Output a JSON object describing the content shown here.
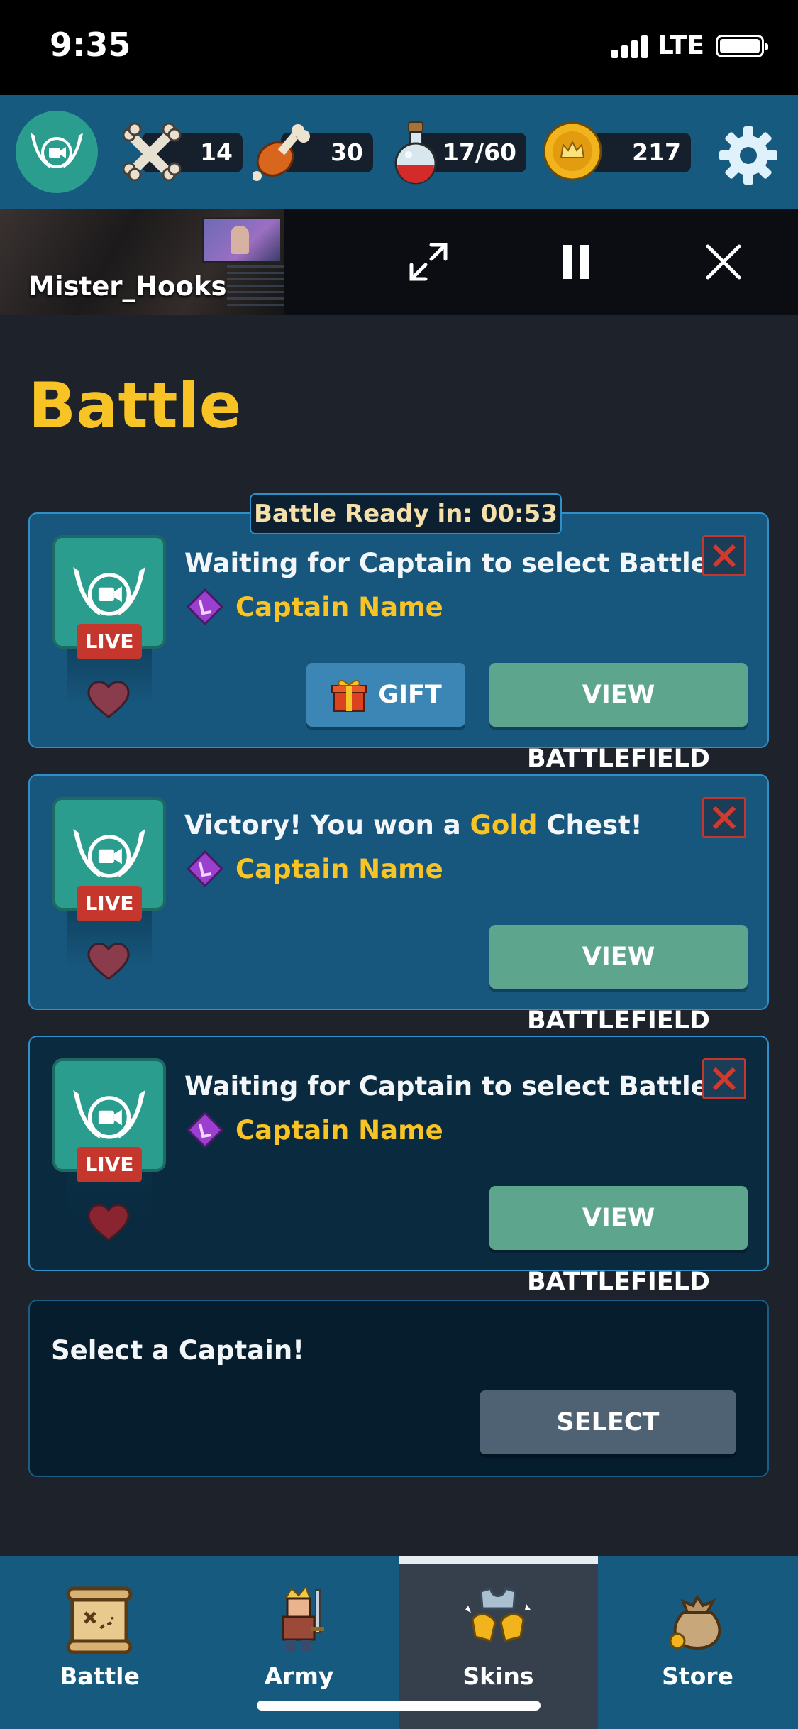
{
  "status_bar": {
    "time": "9:35",
    "network": "LTE"
  },
  "resources": {
    "bones": "14",
    "meat": "30",
    "potion": "17/60",
    "coins": "217"
  },
  "stream": {
    "streamer": "Mister_Hooks"
  },
  "page": {
    "title": "Battle"
  },
  "battle_timer": "Battle Ready in: 00:53",
  "cards": [
    {
      "title": "Waiting for Captain to select Battle",
      "captain": "Captain Name",
      "live": "LIVE",
      "gift_label": "GIFT",
      "view_label": "VIEW BATTLEFIELD"
    },
    {
      "title_prefix": "Victory! You won a ",
      "title_highlight": "Gold",
      "title_suffix": " Chest!",
      "captain": "Captain Name",
      "live": "LIVE",
      "view_label": "VIEW BATTLEFIELD"
    },
    {
      "title": "Waiting for Captain to select Battle",
      "captain": "Captain Name",
      "live": "LIVE",
      "view_label": "VIEW BATTLEFIELD"
    }
  ],
  "select_card": {
    "title": "Select a Captain!",
    "button": "SELECT"
  },
  "tabs": [
    {
      "label": "Battle",
      "icon": "map-scroll-icon"
    },
    {
      "label": "Army",
      "icon": "warrior-icon"
    },
    {
      "label": "Skins",
      "icon": "armor-icon",
      "active": true
    },
    {
      "label": "Store",
      "icon": "coin-bag-icon"
    }
  ],
  "colors": {
    "accent_gold": "#f7c325",
    "panel_blue": "#17577e",
    "button_green": "#5ea58d",
    "live_red": "#c5372c"
  }
}
